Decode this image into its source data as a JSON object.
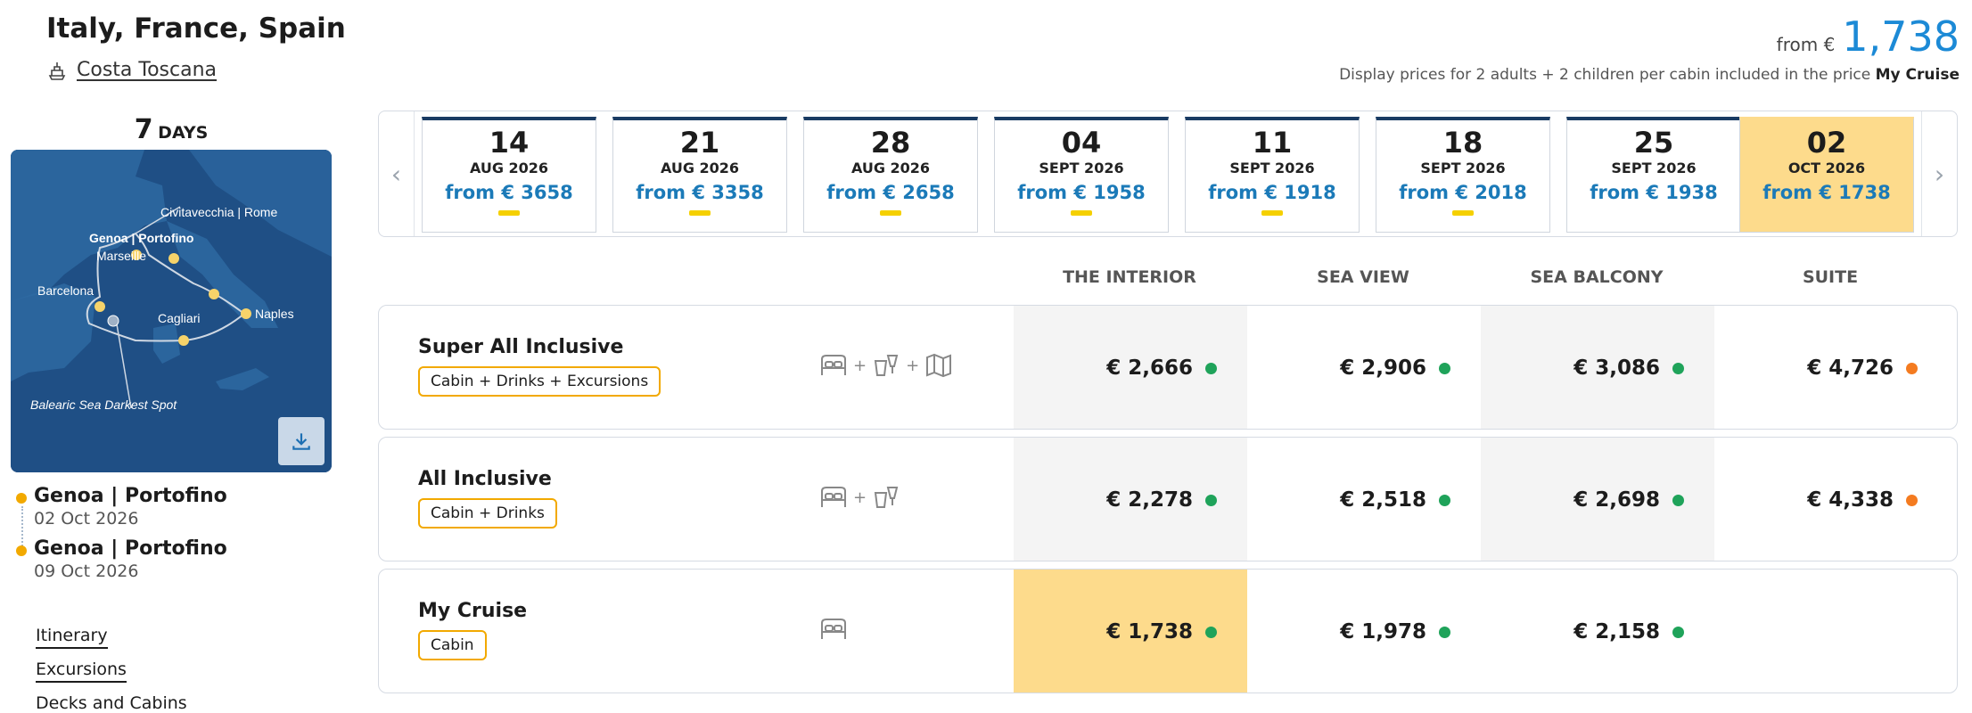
{
  "header": {
    "title": "Italy, France, Spain",
    "ship_name": "Costa Toscana",
    "price_from_label": "from €",
    "price_from_value": "1,738",
    "note_prefix": "Display prices for 2 adults + 2 children per cabin included in the price",
    "note_bold": "My Cruise"
  },
  "duration": {
    "number": "7",
    "label": "DAYS"
  },
  "map": {
    "ports": [
      "Civitavecchia | Rome",
      "Genoa | Portofino",
      "Marseille",
      "Barcelona",
      "Cagliari",
      "Naples"
    ],
    "annotation": "Balearic Sea Darkest Spot",
    "download_icon": "download-icon"
  },
  "route": [
    {
      "name": "Genoa | Portofino",
      "date": "02 Oct 2026"
    },
    {
      "name": "Genoa | Portofino",
      "date": "09 Oct 2026"
    }
  ],
  "side_links": [
    "Itinerary",
    "Excursions",
    "Decks and Cabins"
  ],
  "dates": [
    {
      "day": "14",
      "month": "AUG 2026",
      "price": "from € 3658"
    },
    {
      "day": "21",
      "month": "AUG 2026",
      "price": "from € 3358"
    },
    {
      "day": "28",
      "month": "AUG 2026",
      "price": "from € 2658"
    },
    {
      "day": "04",
      "month": "SEPT 2026",
      "price": "from € 1958"
    },
    {
      "day": "11",
      "month": "SEPT 2026",
      "price": "from € 1918"
    },
    {
      "day": "18",
      "month": "SEPT 2026",
      "price": "from € 2018"
    },
    {
      "day": "25",
      "month": "SEPT 2026",
      "price": "from € 1938"
    },
    {
      "day": "02",
      "month": "OCT 2026",
      "price": "from € 1738"
    }
  ],
  "cabin_headers": [
    "THE INTERIOR",
    "SEA VIEW",
    "SEA BALCONY",
    "SUITE"
  ],
  "packages": [
    {
      "name": "Super All Inclusive",
      "tag": "Cabin + Drinks + Excursions",
      "prices": [
        "€ 2,666",
        "€ 2,906",
        "€ 3,086",
        "€ 4,726"
      ]
    },
    {
      "name": "All Inclusive",
      "tag": "Cabin + Drinks",
      "prices": [
        "€ 2,278",
        "€ 2,518",
        "€ 2,698",
        "€ 4,338"
      ]
    },
    {
      "name": "My Cruise",
      "tag": "Cabin",
      "prices": [
        "€ 1,738",
        "€ 1,978",
        "€ 2,158",
        ""
      ]
    }
  ],
  "colors": {
    "accent_blue": "#1c8ad6",
    "highlight": "#fddb8c",
    "available": "#1fa35a",
    "limited": "#f47b20",
    "tag_border": "#f2a900"
  }
}
